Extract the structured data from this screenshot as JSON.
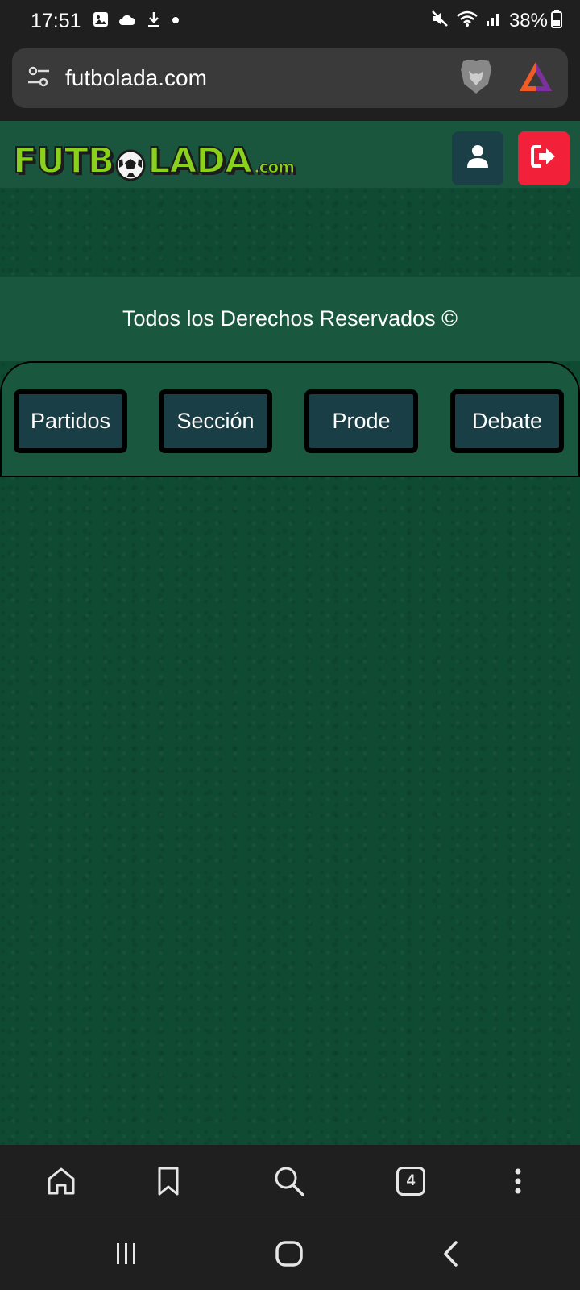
{
  "status_bar": {
    "time": "17:51",
    "battery": "38%",
    "icons": [
      "gallery-icon",
      "cloud-icon",
      "download-icon",
      "dot-icon",
      "mute-icon",
      "wifi-icon",
      "signal-icon",
      "battery-icon"
    ]
  },
  "browser": {
    "url": "futbolada.com",
    "tab_count": "4",
    "toolbar_icons": [
      "home-icon",
      "bookmark-icon",
      "search-icon",
      "tabs-icon",
      "more-icon"
    ]
  },
  "site": {
    "logo_main": "FUTBOLADA",
    "logo_suffix": ".com",
    "footer_text": "Todos los Derechos Reservados ©",
    "nav": {
      "partidos": "Partidos",
      "seccion": "Sección",
      "prode": "Prode",
      "debate": "Debate"
    },
    "colors": {
      "background": "#0f4a33",
      "header": "#1a563e",
      "logout": "#f3203a",
      "user_button": "#1b3f46",
      "nav_button": "#1a3e46",
      "logo_green": "#8ad11c"
    }
  }
}
